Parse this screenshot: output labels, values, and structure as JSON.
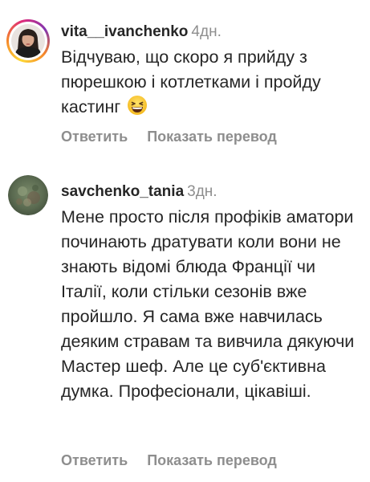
{
  "comments": [
    {
      "username": "vita__ivanchenko",
      "time": "4дн.",
      "text": "Відчуваю, що скоро я прийду з пюрешкою і котлетками і пройду кастинг",
      "emoji": "grinning-squinting-face",
      "reply_label": "Ответить",
      "translate_label": "Показать перевод"
    },
    {
      "username": "savchenko_tania",
      "time": "3дн.",
      "text": "Мене просто після профіків аматори починають дратувати коли вони не знають відомі блюда Франції чи Італії, коли стільки сезонів вже пройшло. Я сама вже навчилась деяким стравам та вивчила дякуючи Мастер шеф. Але це суб'єктивна думка. Професіонали, цікавіші.",
      "reply_label": "Ответить",
      "translate_label": "Показать перевод"
    }
  ]
}
